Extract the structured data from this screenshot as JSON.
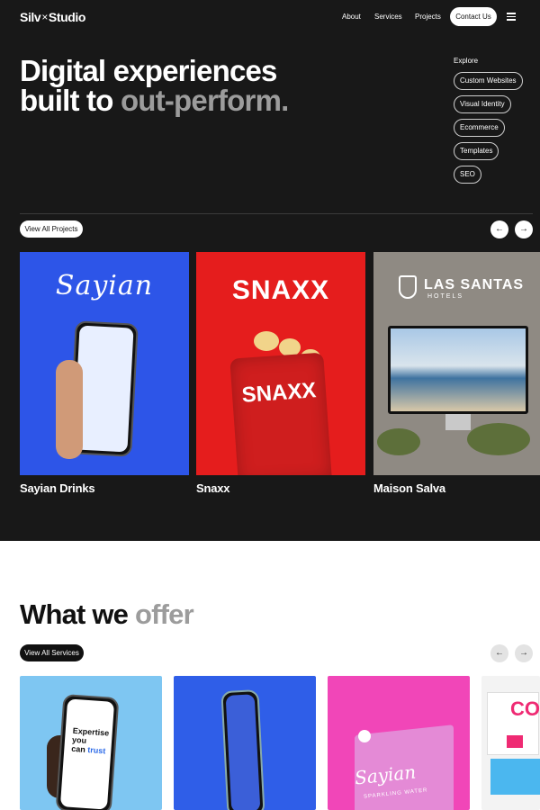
{
  "brand": {
    "left": "Silv",
    "sep": "×",
    "right": "Studio"
  },
  "nav": {
    "about": "About",
    "services": "Services",
    "projects": "Projects",
    "contact": "Contact Us"
  },
  "hero": {
    "line1": "Digital experiences",
    "line2_prefix": "built to ",
    "line2_highlight": "out-perform."
  },
  "explore": {
    "label": "Explore",
    "items": [
      "Custom Websites",
      "Visual Identity",
      "Ecommerce",
      "Templates",
      "SEO"
    ]
  },
  "projects": {
    "view_all": "View All Projects",
    "prev_icon": "←",
    "next_icon": "→",
    "cards": [
      {
        "name": "Sayian Drinks",
        "logo": "Sayian",
        "accent": "#2d55e8"
      },
      {
        "name": "Snaxx",
        "logo": "SNAXX",
        "accent": "#e51d1d"
      },
      {
        "name": "Maison Salva",
        "logo": "LAS SANTAS",
        "sub": "HOTELS",
        "accent": "#8f8a83"
      }
    ]
  },
  "offer": {
    "title_prefix": "What we ",
    "title_highlight": "offer",
    "view_all": "View All Services",
    "prev_icon": "←",
    "next_icon": "→",
    "cards": [
      {
        "kind": "phone",
        "headline": "Expertise you",
        "headline_2": "can ",
        "headline_highlight": "trust",
        "accent": "#7ec6f2"
      },
      {
        "kind": "phone",
        "accent": "#2f5ee8"
      },
      {
        "kind": "packaging",
        "logo": "Sayian",
        "sub": "SPARKLING WATER",
        "accent": "#f146b8"
      },
      {
        "kind": "poster",
        "text": "CO",
        "accent": "#f3f3f3"
      }
    ]
  },
  "colors": {
    "dark_bg": "#181818",
    "muted_text": "#9c9c9c",
    "white": "#ffffff"
  }
}
